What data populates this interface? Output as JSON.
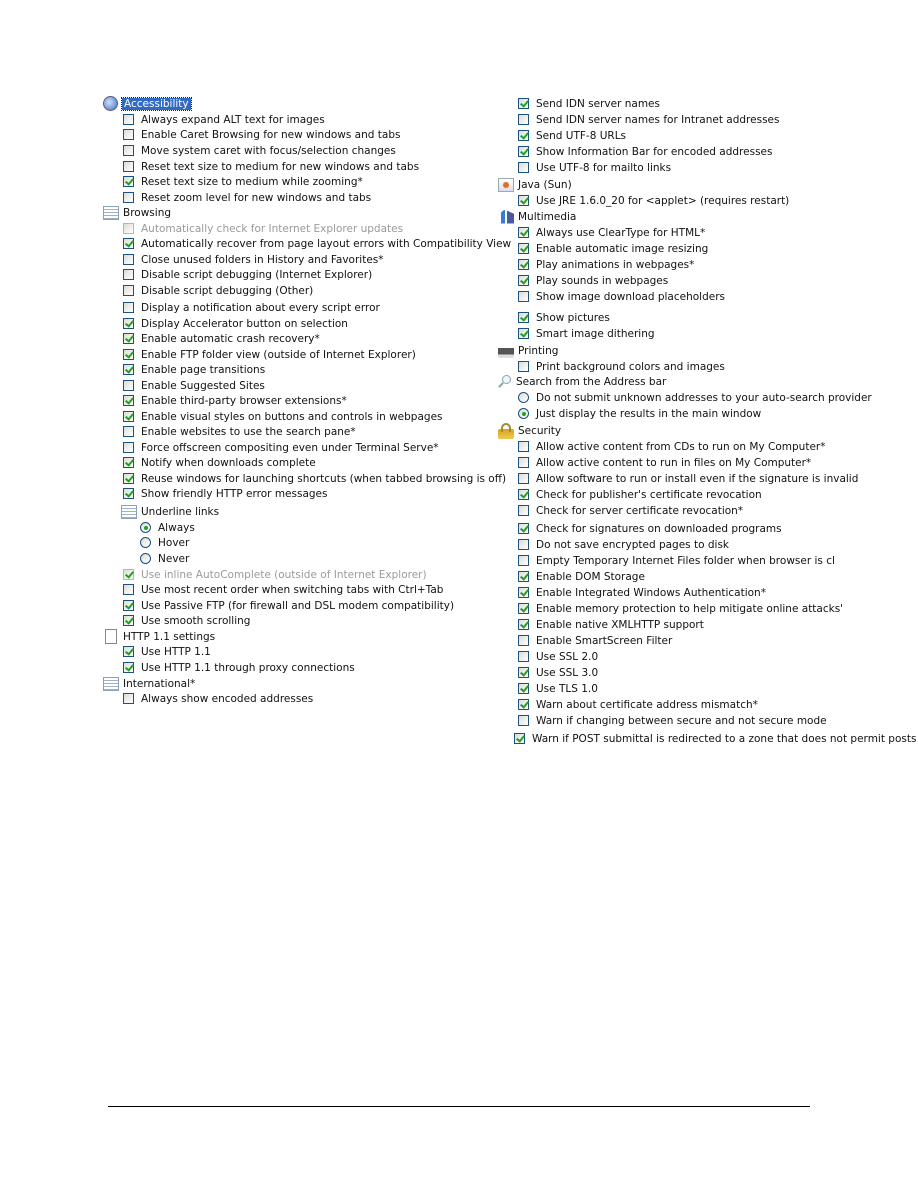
{
  "left_column": [
    {
      "type": "header",
      "icon": "accessibility-icon",
      "label": "Accessibility",
      "selected": true
    },
    {
      "type": "checkbox",
      "label": "Always expand ALT text for images",
      "checked": false
    },
    {
      "type": "checkbox",
      "label": "Enable Caret Browsing for new windows and tabs",
      "checked": false
    },
    {
      "type": "checkbox",
      "label": "Move system caret with focus/selection changes",
      "checked": false
    },
    {
      "type": "checkbox",
      "label": "Reset text size to medium for new windows and tabs",
      "checked": false
    },
    {
      "type": "checkbox",
      "label": "Reset text size to medium while zooming*",
      "checked": true
    },
    {
      "type": "checkbox",
      "label": "Reset zoom level for new windows and tabs",
      "checked": false
    },
    {
      "type": "header",
      "icon": "list-icon",
      "label": "Browsing"
    },
    {
      "type": "checkbox",
      "label": "Automatically check for Internet Explorer updates",
      "checked": false,
      "disabled": true
    },
    {
      "type": "checkbox",
      "label": "Automatically recover from page layout errors with Compatibility View",
      "checked": true
    },
    {
      "type": "checkbox",
      "label": "Close unused folders in History and Favorites*",
      "checked": false
    },
    {
      "type": "checkbox",
      "label": "Disable script debugging (Internet Explorer)",
      "checked": false
    },
    {
      "type": "checkbox",
      "label": "Disable script debugging (Other)",
      "checked": false
    },
    {
      "type": "checkbox",
      "label": "Display a notification about every script error",
      "checked": false
    },
    {
      "type": "checkbox",
      "label": "Display Accelerator button on selection",
      "checked": true
    },
    {
      "type": "checkbox",
      "label": "Enable automatic crash recovery*",
      "checked": true
    },
    {
      "type": "checkbox",
      "label": "Enable FTP folder view (outside of Internet Explorer)",
      "checked": true
    },
    {
      "type": "checkbox",
      "label": "Enable page transitions",
      "checked": true
    },
    {
      "type": "checkbox",
      "label": "Enable Suggested Sites",
      "checked": false
    },
    {
      "type": "checkbox",
      "label": "Enable third-party browser extensions*",
      "checked": true
    },
    {
      "type": "checkbox",
      "label": "Enable visual styles on buttons and controls in webpages",
      "checked": true
    },
    {
      "type": "checkbox",
      "label": "Enable websites to use the search pane*",
      "checked": false
    },
    {
      "type": "checkbox",
      "label": "Force offscreen compositing even under Terminal Serve*",
      "checked": false
    },
    {
      "type": "checkbox",
      "label": "Notify when downloads complete",
      "checked": true
    },
    {
      "type": "checkbox",
      "label": "Reuse windows for launching shortcuts (when tabbed browsing is off)",
      "checked": true
    },
    {
      "type": "checkbox",
      "label": "Show friendly HTTP error messages",
      "checked": true
    },
    {
      "type": "subheader",
      "icon": "list-icon",
      "label": "Underline links"
    },
    {
      "type": "radio",
      "label": "Always",
      "checked": true
    },
    {
      "type": "radio",
      "label": "Hover",
      "checked": false
    },
    {
      "type": "radio",
      "label": "Never",
      "checked": false
    },
    {
      "type": "checkbox",
      "label": "Use inline AutoComplete (outside of Internet Explorer)",
      "checked": true,
      "disabled": true
    },
    {
      "type": "checkbox",
      "label": "Use most recent order when switching tabs with Ctrl+Tab",
      "checked": false
    },
    {
      "type": "checkbox",
      "label": "Use Passive FTP (for firewall and DSL modem compatibility)",
      "checked": true
    },
    {
      "type": "checkbox",
      "label": "Use smooth scrolling",
      "checked": true
    },
    {
      "type": "header",
      "icon": "page-icon",
      "label": "HTTP 1.1 settings"
    },
    {
      "type": "checkbox",
      "label": "Use HTTP 1.1",
      "checked": true
    },
    {
      "type": "checkbox",
      "label": "Use HTTP 1.1 through proxy connections",
      "checked": true
    },
    {
      "type": "header",
      "icon": "list-icon",
      "label": "International*"
    },
    {
      "type": "checkbox",
      "label": "Always show encoded addresses",
      "checked": false
    }
  ],
  "right_column": [
    {
      "type": "checkbox",
      "label": "Send IDN server names",
      "checked": true
    },
    {
      "type": "checkbox",
      "label": "Send IDN server names for Intranet addresses",
      "checked": false
    },
    {
      "type": "checkbox",
      "label": "Send UTF-8 URLs",
      "checked": true
    },
    {
      "type": "checkbox",
      "label": "Show Information Bar for encoded addresses",
      "checked": true
    },
    {
      "type": "checkbox",
      "label": "Use UTF-8 for mailto links",
      "checked": false
    },
    {
      "type": "header",
      "icon": "java-icon",
      "label": "Java (Sun)"
    },
    {
      "type": "checkbox",
      "label": "Use JRE 1.6.0_20 for <applet> (requires restart)",
      "checked": true
    },
    {
      "type": "header",
      "icon": "multimedia-icon",
      "label": "Multimedia"
    },
    {
      "type": "checkbox",
      "label": "Always use ClearType for HTML*",
      "checked": true
    },
    {
      "type": "checkbox",
      "label": "Enable automatic image resizing",
      "checked": true
    },
    {
      "type": "checkbox",
      "label": "Play animations in webpages*",
      "checked": true
    },
    {
      "type": "checkbox",
      "label": "Play sounds in webpages",
      "checked": true
    },
    {
      "type": "checkbox",
      "label": "Show image download placeholders",
      "checked": false
    },
    {
      "type": "checkbox",
      "label": "Show pictures",
      "checked": true
    },
    {
      "type": "checkbox",
      "label": "Smart image dithering",
      "checked": true
    },
    {
      "type": "header",
      "icon": "printer-icon",
      "label": "Printing"
    },
    {
      "type": "checkbox",
      "label": "Print background colors and images",
      "checked": false
    },
    {
      "type": "header",
      "icon": "search-icon",
      "label": "Search from the Address bar"
    },
    {
      "type": "radio",
      "label": "Do not submit unknown addresses to your auto-search provider",
      "checked": false
    },
    {
      "type": "radio",
      "label": "Just display the results in the main window",
      "checked": true
    },
    {
      "type": "header",
      "icon": "lock-icon",
      "label": "Security"
    },
    {
      "type": "checkbox",
      "label": "Allow active content from CDs to run on My Computer*",
      "checked": false
    },
    {
      "type": "checkbox",
      "label": "Allow active content to run in files on My Computer*",
      "checked": false
    },
    {
      "type": "checkbox",
      "label": "Allow software to run or install even if the signature is invalid",
      "checked": false
    },
    {
      "type": "checkbox",
      "label": "Check for publisher's certificate revocation",
      "checked": true
    },
    {
      "type": "checkbox",
      "label": "Check for server certificate revocation*",
      "checked": false
    },
    {
      "type": "checkbox",
      "label": "Check for signatures on downloaded programs",
      "checked": true
    },
    {
      "type": "checkbox",
      "label": "Do not save encrypted pages to disk",
      "checked": false
    },
    {
      "type": "checkbox",
      "label": "Empty Temporary Internet Files folder when browser is cl",
      "checked": false
    },
    {
      "type": "checkbox",
      "label": "Enable DOM Storage",
      "checked": true
    },
    {
      "type": "checkbox",
      "label": "Enable Integrated Windows Authentication*",
      "checked": true
    },
    {
      "type": "checkbox",
      "label": "Enable memory protection to help mitigate online attacks'",
      "checked": true
    },
    {
      "type": "checkbox",
      "label": "Enable native XMLHTTP support",
      "checked": true
    },
    {
      "type": "checkbox",
      "label": "Enable SmartScreen Filter",
      "checked": false
    },
    {
      "type": "checkbox",
      "label": "Use SSL 2.0",
      "checked": false
    },
    {
      "type": "checkbox",
      "label": "Use SSL 3.0",
      "checked": true
    },
    {
      "type": "checkbox",
      "label": "Use TLS 1.0",
      "checked": true
    },
    {
      "type": "checkbox",
      "label": "Warn about certificate address mismatch*",
      "checked": true
    },
    {
      "type": "checkbox",
      "label": "Warn if changing between secure and not secure mode",
      "checked": false
    },
    {
      "type": "checkbox",
      "label": "Warn if POST submittal is redirected to a zone that does not permit posts",
      "checked": true
    }
  ]
}
